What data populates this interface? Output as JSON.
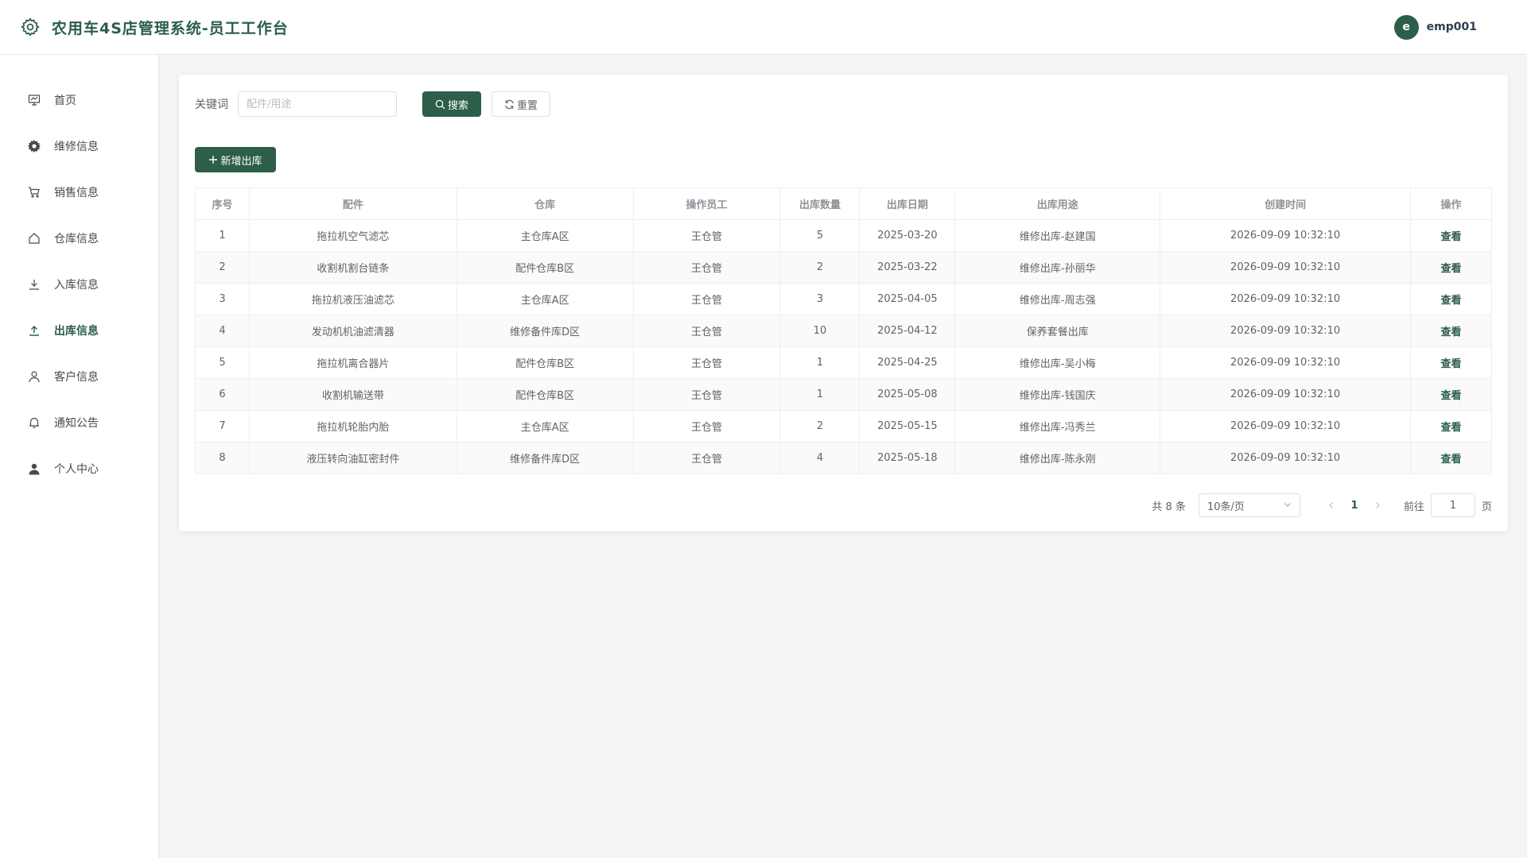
{
  "header": {
    "title": "农用车4S店管理系统-员工工作台",
    "avatar_letter": "e",
    "username": "emp001"
  },
  "sidebar": {
    "items": [
      {
        "label": "首页",
        "icon": "presentation-icon"
      },
      {
        "label": "维修信息",
        "icon": "gear-icon"
      },
      {
        "label": "销售信息",
        "icon": "cart-icon"
      },
      {
        "label": "仓库信息",
        "icon": "house-icon"
      },
      {
        "label": "入库信息",
        "icon": "download-icon"
      },
      {
        "label": "出库信息",
        "icon": "upload-icon",
        "active": true
      },
      {
        "label": "客户信息",
        "icon": "user-icon"
      },
      {
        "label": "通知公告",
        "icon": "bell-icon"
      },
      {
        "label": "个人中心",
        "icon": "user-filled-icon"
      }
    ]
  },
  "search": {
    "label": "关键词",
    "placeholder": "配件/用途",
    "value": "",
    "search_btn": "搜索",
    "reset_btn": "重置"
  },
  "toolbar": {
    "add_btn": "新增出库"
  },
  "table": {
    "headers": [
      "序号",
      "配件",
      "仓库",
      "操作员工",
      "出库数量",
      "出库日期",
      "出库用途",
      "创建时间",
      "操作"
    ],
    "rows": [
      [
        "1",
        "拖拉机空气滤芯",
        "主仓库A区",
        "王仓管",
        "5",
        "2025-03-20",
        "维修出库-赵建国",
        "2026-09-09 10:32:10",
        "查看"
      ],
      [
        "2",
        "收割机割台链条",
        "配件仓库B区",
        "王仓管",
        "2",
        "2025-03-22",
        "维修出库-孙丽华",
        "2026-09-09 10:32:10",
        "查看"
      ],
      [
        "3",
        "拖拉机液压油滤芯",
        "主仓库A区",
        "王仓管",
        "3",
        "2025-04-05",
        "维修出库-周志强",
        "2026-09-09 10:32:10",
        "查看"
      ],
      [
        "4",
        "发动机机油滤清器",
        "维修备件库D区",
        "王仓管",
        "10",
        "2025-04-12",
        "保养套餐出库",
        "2026-09-09 10:32:10",
        "查看"
      ],
      [
        "5",
        "拖拉机离合器片",
        "配件仓库B区",
        "王仓管",
        "1",
        "2025-04-25",
        "维修出库-吴小梅",
        "2026-09-09 10:32:10",
        "查看"
      ],
      [
        "6",
        "收割机输送带",
        "配件仓库B区",
        "王仓管",
        "1",
        "2025-05-08",
        "维修出库-钱国庆",
        "2026-09-09 10:32:10",
        "查看"
      ],
      [
        "7",
        "拖拉机轮胎内胎",
        "主仓库A区",
        "王仓管",
        "2",
        "2025-05-15",
        "维修出库-冯秀兰",
        "2026-09-09 10:32:10",
        "查看"
      ],
      [
        "8",
        "液压转向油缸密封件",
        "维修备件库D区",
        "王仓管",
        "4",
        "2025-05-18",
        "维修出库-陈永刚",
        "2026-09-09 10:32:10",
        "查看"
      ]
    ]
  },
  "pagination": {
    "total": "共 8 条",
    "page_size": "10条/页",
    "current_page": "1",
    "goto_label": "前往",
    "goto_value": "1",
    "page_suffix": "页"
  },
  "colors": {
    "primary": "#2c5e4a",
    "background": "#f3f5f4"
  }
}
